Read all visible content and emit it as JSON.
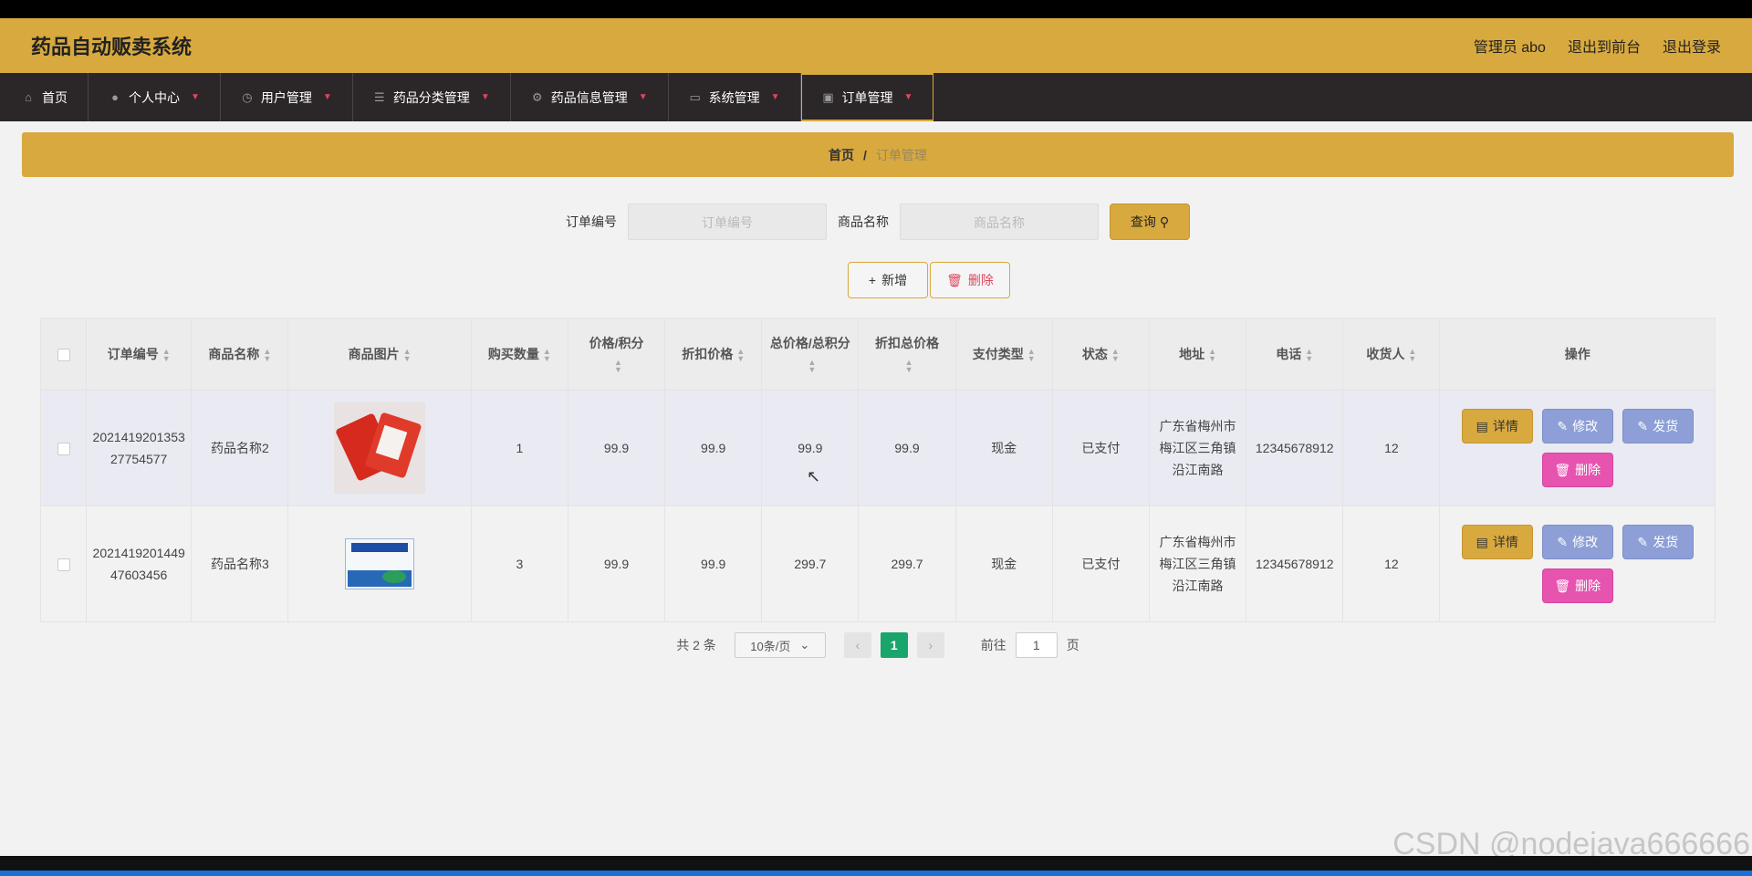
{
  "app": {
    "title": "药品自动贩卖系统",
    "admin_label": "管理员 abo",
    "back_to_front": "退出到前台",
    "logout": "退出登录"
  },
  "nav": [
    {
      "label": "首页",
      "icon": "home-icon"
    },
    {
      "label": "个人中心",
      "icon": "user-icon"
    },
    {
      "label": "用户管理",
      "icon": "clock-icon"
    },
    {
      "label": "药品分类管理",
      "icon": "list-icon"
    },
    {
      "label": "药品信息管理",
      "icon": "gear-icon"
    },
    {
      "label": "系统管理",
      "icon": "monitor-icon"
    },
    {
      "label": "订单管理",
      "icon": "clipboard-icon"
    }
  ],
  "breadcrumb": {
    "home": "首页",
    "sep": "/",
    "current": "订单管理"
  },
  "search": {
    "order_label": "订单编号",
    "order_placeholder": "订单编号",
    "product_label": "商品名称",
    "product_placeholder": "商品名称",
    "query_button": "查询"
  },
  "toolbar": {
    "add_label": "新增",
    "delete_label": "删除"
  },
  "table": {
    "headers": [
      "订单编号",
      "商品名称",
      "商品图片",
      "购买数量",
      "价格/积分",
      "折扣价格",
      "总价格/总积分",
      "折扣总价格",
      "支付类型",
      "状态",
      "地址",
      "电话",
      "收货人",
      "操作"
    ],
    "rows": [
      {
        "order_no": "202141920135327754577",
        "product": "药品名称2",
        "qty": "1",
        "price": "99.9",
        "discount_price": "99.9",
        "total": "99.9",
        "discount_total": "99.9",
        "pay_type": "现金",
        "status": "已支付",
        "address": "广东省梅州市梅江区三角镇沿江南路",
        "phone": "12345678912",
        "receiver": "12"
      },
      {
        "order_no": "202141920144947603456",
        "product": "药品名称3",
        "qty": "3",
        "price": "99.9",
        "discount_price": "99.9",
        "total": "299.7",
        "discount_total": "299.7",
        "pay_type": "现金",
        "status": "已支付",
        "address": "广东省梅州市梅江区三角镇沿江南路",
        "phone": "12345678912",
        "receiver": "12"
      }
    ],
    "op_labels": {
      "detail": "详情",
      "edit": "修改",
      "ship": "发货",
      "delete": "删除"
    }
  },
  "pager": {
    "total": "共 2 条",
    "page_size": "10条/页",
    "current": "1",
    "goto_prefix": "前往",
    "goto_value": "1",
    "goto_suffix": "页"
  },
  "watermark": "CSDN @nodejava666666",
  "colors": {
    "accent": "#d8a93e",
    "nav_bg": "#2b2627",
    "page_active": "#1aa56c",
    "edit_btn": "#8d9fd6",
    "delete_btn": "#e654b0"
  }
}
